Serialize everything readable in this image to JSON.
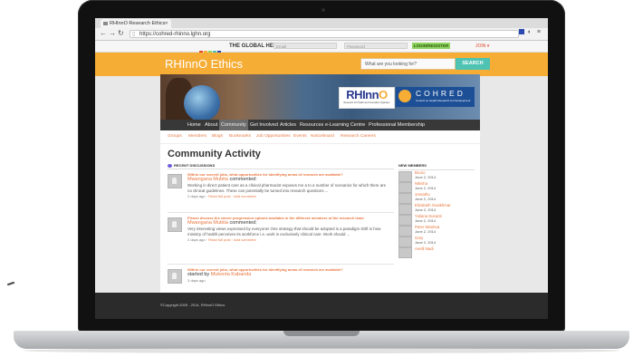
{
  "browser": {
    "tab_title": "RHInnO Research Ethics",
    "url": "https://cohred-rhinno.lghn.org"
  },
  "network_bar": {
    "title": "THE GLOBAL HEALTH NETWORK",
    "email_placeholder": "Email",
    "password_placeholder": "Password",
    "login_label": "LOGIN/REGISTER",
    "signup_label": "JOIN"
  },
  "header": {
    "brand": "RHInnO Ethics",
    "search_placeholder": "What are you looking for?",
    "search_label": "SEARCH"
  },
  "logos": {
    "rhinno_main": "RHInn",
    "rhinno_o": "O",
    "rhinno_sub": "Research for Health and Innovation Organiser",
    "cohred_title": "COHRED",
    "cohred_sub": "Council on Health Research for Development"
  },
  "main_nav": [
    "Home",
    "About",
    "Community",
    "Get Involved",
    "Articles",
    "Resources",
    "e-Learning Centre",
    "Professional Membership"
  ],
  "sub_nav": [
    "Groups",
    "Members",
    "Blogs",
    "Bookmarks",
    "Job Opportunities",
    "Events",
    "Noticeboard",
    "Research Careers"
  ],
  "page_title": "Community Activity",
  "recent_heading": "RECENT DISCUSSIONS",
  "discussions": [
    {
      "link": "Within our current jobs, what opportunities for identifying areas of research are available?",
      "user": "Mwangana Mubita",
      "action": "commented:",
      "text": "Working in direct patient care as a clinical pharmacist exposes me a to a number of scenarios for which there are no clinical guidelines. These can potentially be turned into research questions ...",
      "time": "2 days ago",
      "reply": "Read full post",
      "add": "Add comment"
    },
    {
      "link": "Please discuss the career progression options available in the different members of the research team",
      "user": "Mwangana Mubita",
      "action": "commented:",
      "text": "Very interesting views expressed by everyone! One strategy that should be adopted is a paradigm shift in how ministry of health perceives its workforce i.e. work is exclusively clinical care. Work should ...",
      "time": "2 days ago",
      "reply": "Read full post",
      "add": "Add comment"
    },
    {
      "link": "Within our current jobs, what opportunities for identifying areas of research are available?",
      "user": "Mukonta Kabanda",
      "action": "started by",
      "text": "",
      "time": "3 days ago",
      "reply": "",
      "add": ""
    }
  ],
  "new_members_heading": "NEW MEMBERS",
  "members": [
    {
      "name": "Bruno",
      "date": "June 2, 2014"
    },
    {
      "name": "Nikisha",
      "date": "June 2, 2014"
    },
    {
      "name": "omnathu",
      "date": "June 2, 2014"
    },
    {
      "name": "Elizabeth Gwakhmar",
      "date": "June 2, 2014"
    },
    {
      "name": "Yuliana Susanti",
      "date": "June 2, 2014"
    },
    {
      "name": "Peter Wanbua",
      "date": "June 2, 2014"
    },
    {
      "name": "Gary",
      "date": "June 2, 2014"
    },
    {
      "name": "Anelli Nadi",
      "date": ""
    }
  ],
  "footer": {
    "copyright": "©Copyright 2009 - 2014, RHInnO Ethics"
  },
  "colors": {
    "orange": "#f6ad35",
    "teal": "#4ec3b3",
    "link": "#e8763f",
    "nav_dark": "#383838",
    "cohred_blue": "#1d4f96"
  }
}
